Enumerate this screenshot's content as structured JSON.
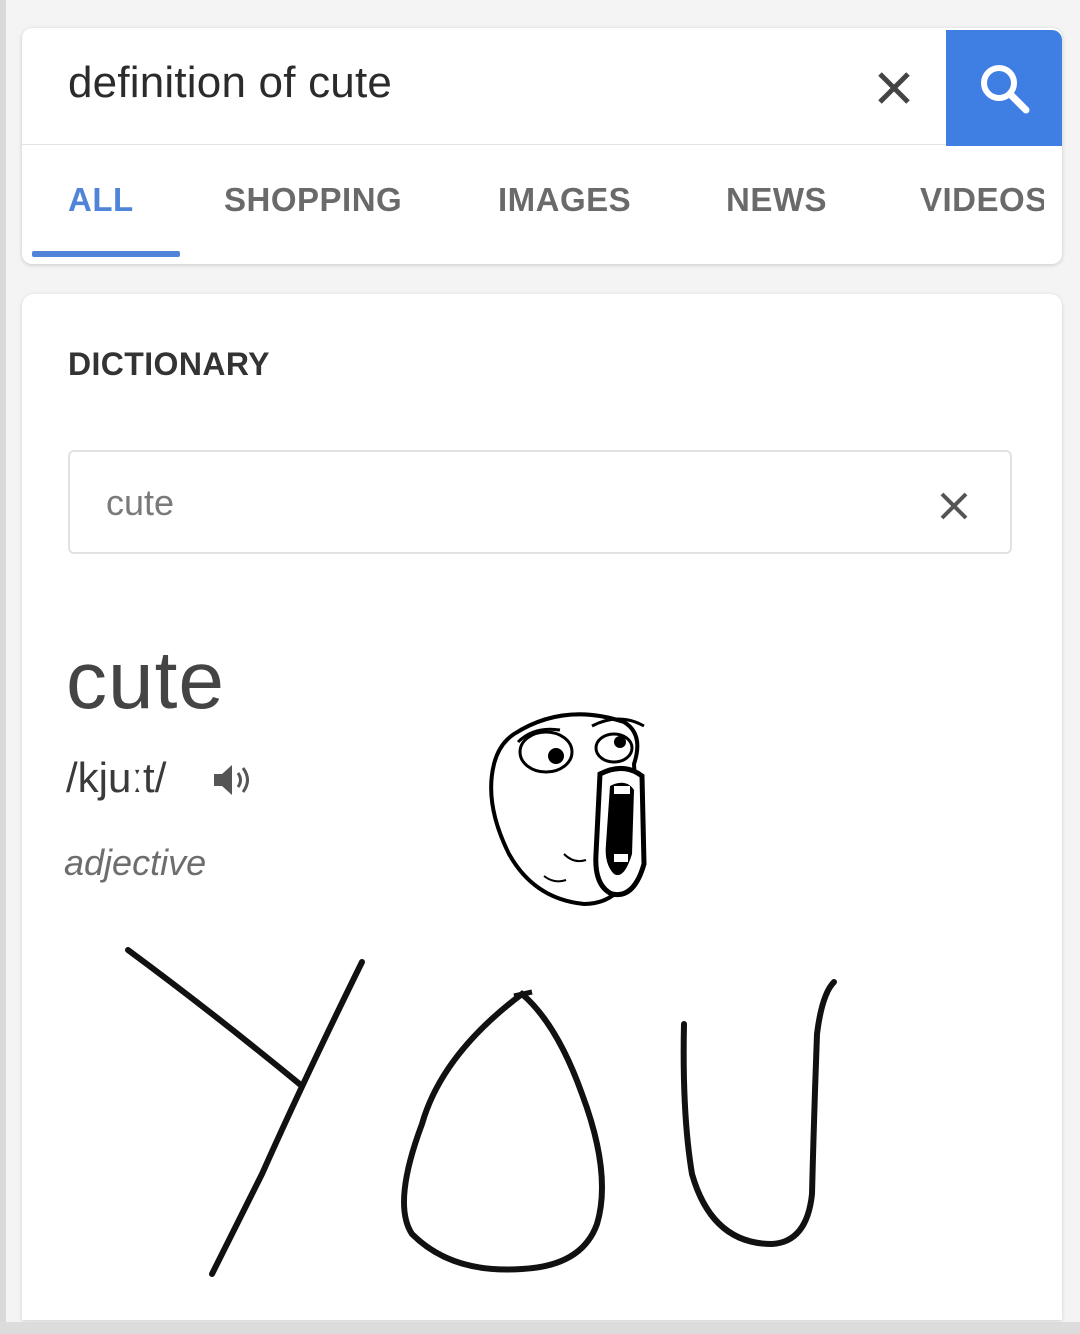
{
  "search": {
    "query": "definition of cute",
    "clear_icon": "close-icon",
    "submit_icon": "search-icon",
    "accent_color": "#3f7ee3"
  },
  "tabs": [
    {
      "label": "ALL",
      "active": true
    },
    {
      "label": "SHOPPING",
      "active": false
    },
    {
      "label": "IMAGES",
      "active": false
    },
    {
      "label": "NEWS",
      "active": false
    },
    {
      "label": "VIDEOS",
      "active": false
    }
  ],
  "dictionary": {
    "heading": "DICTIONARY",
    "input_value": "cute",
    "clear_icon": "close-icon",
    "word": "cute",
    "phonetic": "/kjuːt/",
    "audio_icon": "speaker-icon",
    "part_of_speech": "adjective"
  },
  "overlay": {
    "face_icon": "rage-face-lol",
    "handwritten_text": "YOU"
  }
}
